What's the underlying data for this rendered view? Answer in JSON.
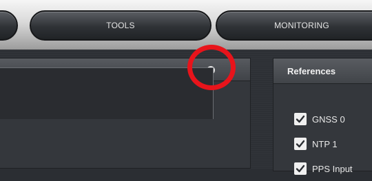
{
  "nav": {
    "tabs": [
      {
        "label": ""
      },
      {
        "label": "TOOLS"
      },
      {
        "label": "MONITORING"
      }
    ]
  },
  "left_panel": {
    "close_icon": "close-icon",
    "highlight_color": "#e8141b"
  },
  "references": {
    "title": "References",
    "items": [
      {
        "label": "GNSS 0",
        "checked": true
      },
      {
        "label": "NTP 1",
        "checked": true
      },
      {
        "label": "PPS Input",
        "checked": true
      }
    ]
  }
}
